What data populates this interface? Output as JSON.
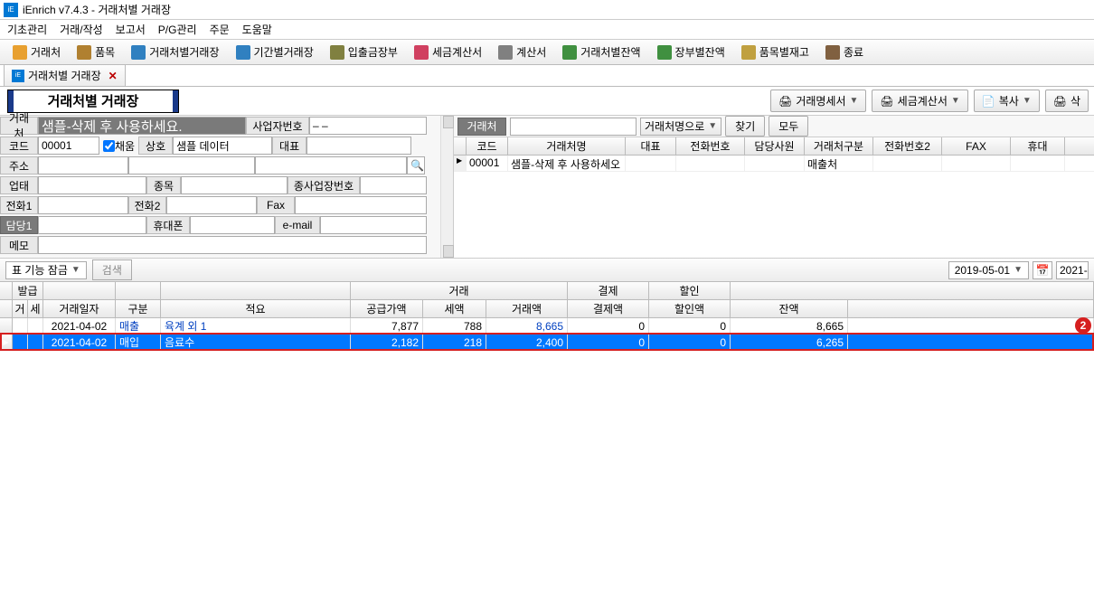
{
  "window": {
    "title": "iEnrich v7.4.3 - 거래처별 거래장"
  },
  "menus": [
    "기초관리",
    "거래/작성",
    "보고서",
    "P/G관리",
    "주문",
    "도움말"
  ],
  "toolbar": [
    {
      "label": "거래처",
      "icon": "user-icon",
      "color": "#e8a030"
    },
    {
      "label": "품목",
      "icon": "package-icon",
      "color": "#b08030"
    },
    {
      "label": "거래처별거래장",
      "icon": "ledger-icon",
      "color": "#3080c0"
    },
    {
      "label": "기간별거래장",
      "icon": "period-icon",
      "color": "#3080c0"
    },
    {
      "label": "입출금장부",
      "icon": "cashbook-icon",
      "color": "#808040"
    },
    {
      "label": "세금계산서",
      "icon": "tax-icon",
      "color": "#d04060"
    },
    {
      "label": "계산서",
      "icon": "invoice-icon",
      "color": "#808080"
    },
    {
      "label": "거래처별잔액",
      "icon": "balance-icon",
      "color": "#409040"
    },
    {
      "label": "장부별잔액",
      "icon": "book-balance-icon",
      "color": "#409040"
    },
    {
      "label": "품목별재고",
      "icon": "stock-icon",
      "color": "#c0a040"
    },
    {
      "label": "종료",
      "icon": "exit-icon",
      "color": "#806040"
    }
  ],
  "tab": {
    "label": "거래처별 거래장"
  },
  "page_title": "거래처별 거래장",
  "header_buttons": {
    "b1": "거래명세서",
    "b2": "세금계산서",
    "b3": "복사",
    "b4": "삭"
  },
  "form": {
    "vendor_label": "거래처",
    "vendor_value": "샘플-삭제 후 사용하세요.",
    "bizno_label": "사업자번호",
    "bizno_value": "    –    – ",
    "code_label": "코드",
    "code_value": "00001",
    "chaeum_label": "채움",
    "sangho_label": "상호",
    "sangho_value": "샘플 데이터",
    "daepyo_label": "대표",
    "daepyo_value": "",
    "juso_label": "주소",
    "juso_value": "",
    "eoptae_label": "업태",
    "jongmok_label": "종목",
    "jongbz_label": "종사업장번호",
    "tel1_label": "전화1",
    "tel2_label": "전화2",
    "fax_label": "Fax",
    "damdang_label": "담당1",
    "hp_label": "휴대폰",
    "email_label": "e-mail",
    "memo_label": "메모"
  },
  "right_search": {
    "vendor_btn": "거래처",
    "mode": "거래처명으로",
    "find": "찾기",
    "all": "모두"
  },
  "right_grid": {
    "headers": [
      "",
      "코드",
      "거래처명",
      "대표",
      "전화번호",
      "담당사원",
      "거래처구분",
      "전화번호2",
      "FAX",
      "휴대"
    ],
    "row": {
      "code": "00001",
      "name": "샘플-삭제 후 사용하세오",
      "gubun": "매출처"
    }
  },
  "midbar": {
    "lock": "표 기능 잠금",
    "search": "검색",
    "date": "2019-05-01",
    "date2": "2021-"
  },
  "ledger_head1": {
    "balgeup": "발급",
    "georae": "거래",
    "gyeolje": "결제",
    "harin": "할인"
  },
  "ledger_head2": [
    "",
    "거",
    "세",
    "거래일자",
    "구분",
    "적요",
    "공급가액",
    "세액",
    "거래액",
    "결제액",
    "할인액",
    "잔액"
  ],
  "ledger_rows": [
    {
      "date": "2021-04-02",
      "gubun": "매출",
      "jeokyo": "육계 외 1",
      "supply": "7,877",
      "tax": "788",
      "amount": "8,665",
      "pay": "0",
      "discount": "0",
      "balance": "8,665",
      "selected": false
    },
    {
      "date": "2021-04-02",
      "gubun": "매입",
      "jeokyo": "음료수",
      "supply": "2,182",
      "tax": "218",
      "amount": "2,400",
      "pay": "0",
      "discount": "0",
      "balance": "6,265",
      "selected": true
    }
  ],
  "badge": "2",
  "chart_data": null
}
